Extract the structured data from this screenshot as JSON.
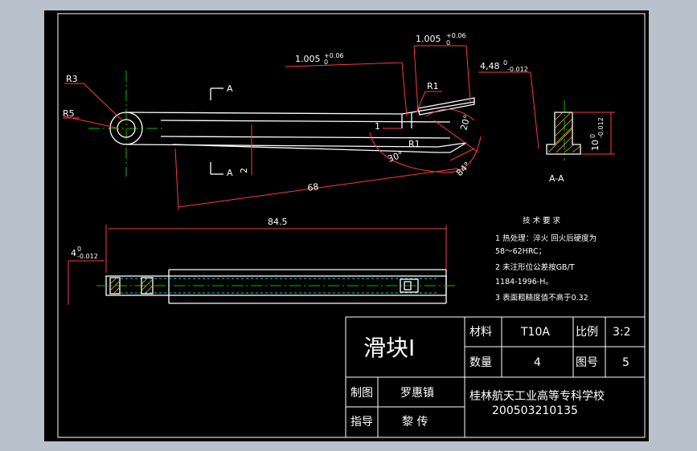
{
  "colors": {
    "frame_background": "#b9c1cc",
    "sheet_background": "#000000",
    "geometry": "#ffffff",
    "dimensions": "#ff3a3a",
    "center_lines": "#00c000",
    "hidden_lines": "#00d0d0",
    "hatch": "#e6c400"
  },
  "dimensions": {
    "r3": "R3",
    "r5": "R5",
    "r1_top": "R1",
    "r1_bottom": "R1",
    "tol_left": "1.005",
    "tol_left_sup": "+0.06",
    "tol_left_sub": "0",
    "tol_right": "1.005",
    "tol_right_sup": "+0.06",
    "tol_right_sub": "0",
    "len_448": "4,48",
    "len_448_sup": "0",
    "len_448_sub": "-0.012",
    "one": "1",
    "angle_20": "20°",
    "angle_30": "30°",
    "angle_84": "84°",
    "two": "2",
    "len_68": "68",
    "section_a_top": "A",
    "section_a_bottom": "A",
    "section_label": "A-A",
    "ten": "10",
    "ten_sup": "0",
    "ten_sub": "-0.012",
    "len_845": "84.5",
    "four": "4",
    "four_sup": "0",
    "four_sub": "-0.012"
  },
  "tech_notes": {
    "title": "技 术 要 求",
    "lines": [
      "1 热处理：淬火 回火后硬度为",
      "58～62HRC；",
      "2 未注形位公差按GB/T",
      "1184-1996-H。",
      "3 表面粗糙度值不高于0.32"
    ]
  },
  "title_block": {
    "part_name": "滑块Ⅰ",
    "material_label": "材料",
    "material_value": "T10A",
    "scale_label": "比例",
    "scale_value": "3:2",
    "quantity_label": "数量",
    "quantity_value": "4",
    "drawing_no_label": "图号",
    "drawing_no_value": "5",
    "drawn_by_label": "制图",
    "drawn_by_value": "罗惠镇",
    "supervisor_label": "指导",
    "supervisor_value": "黎  传",
    "school": "桂林航天工业高等专科学校",
    "student_id": "200503210135"
  }
}
